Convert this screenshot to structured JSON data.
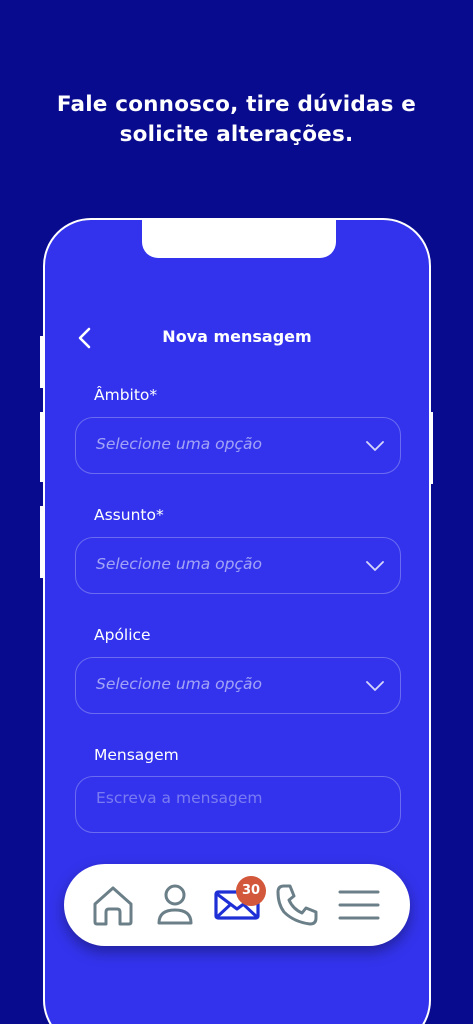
{
  "headline": {
    "line1": "Fale connosco, tire dúvidas e",
    "line2": "solicite alterações."
  },
  "screen": {
    "title": "Nova mensagem",
    "fields": [
      {
        "label": "Âmbito*",
        "placeholder": "Selecione uma opção"
      },
      {
        "label": "Assunto*",
        "placeholder": "Selecione uma opção"
      },
      {
        "label": "Apólice",
        "placeholder": "Selecione uma opção"
      }
    ],
    "message": {
      "label": "Mensagem",
      "placeholder": "Escreva a mensagem"
    }
  },
  "tabbar": {
    "items": [
      "home-icon",
      "profile-icon",
      "mail-icon",
      "phone-icon",
      "menu-icon"
    ],
    "mail_badge": "30"
  },
  "colors": {
    "background": "#090b8f",
    "screen": "#3333ed",
    "icon": "#6b7f88",
    "mail_icon": "#1f2fd6",
    "badge": "#d2573b"
  }
}
